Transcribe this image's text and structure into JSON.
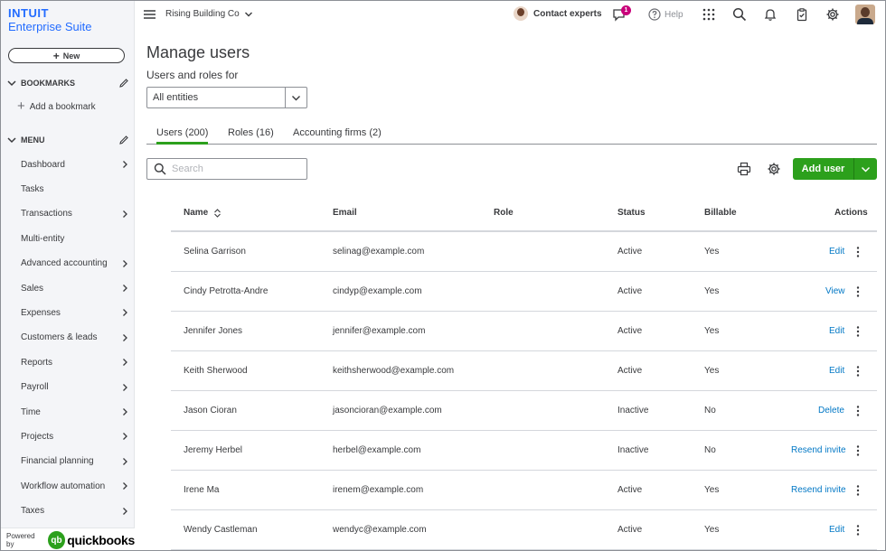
{
  "brand": {
    "intuit": "INTUIT",
    "suite": "Enterprise Suite"
  },
  "sidebar": {
    "new_label": "New",
    "bookmarks_header": "BOOKMARKS",
    "add_bookmark": "Add a bookmark",
    "menu_header": "MENU",
    "items": [
      {
        "label": "Dashboard",
        "chevron": true
      },
      {
        "label": "Tasks",
        "chevron": false
      },
      {
        "label": "Transactions",
        "chevron": true
      },
      {
        "label": "Multi-entity",
        "chevron": false
      },
      {
        "label": "Advanced accounting",
        "chevron": true
      },
      {
        "label": "Sales",
        "chevron": true
      },
      {
        "label": "Expenses",
        "chevron": true
      },
      {
        "label": "Customers & leads",
        "chevron": true
      },
      {
        "label": "Reports",
        "chevron": true
      },
      {
        "label": "Payroll",
        "chevron": true
      },
      {
        "label": "Time",
        "chevron": true
      },
      {
        "label": "Projects",
        "chevron": true
      },
      {
        "label": "Financial planning",
        "chevron": true
      },
      {
        "label": "Workflow automation",
        "chevron": true
      },
      {
        "label": "Taxes",
        "chevron": true
      }
    ],
    "powered_by": "Powered by",
    "qb_mark": "qb",
    "qb_word": "quickbooks"
  },
  "topbar": {
    "company": "Rising Building Co",
    "contact_experts": "Contact experts",
    "notification_count": "1",
    "help": "Help"
  },
  "main": {
    "title": "Manage users",
    "subtitle": "Users and roles for",
    "entity_select": "All entities",
    "tabs": [
      {
        "label": "Users (200)",
        "active": true
      },
      {
        "label": "Roles (16)",
        "active": false
      },
      {
        "label": "Accounting firms (2)",
        "active": false
      }
    ],
    "search_placeholder": "Search",
    "add_user": "Add user"
  },
  "table": {
    "headers": {
      "name": "Name",
      "email": "Email",
      "role": "Role",
      "status": "Status",
      "billable": "Billable",
      "actions": "Actions"
    },
    "rows": [
      {
        "name": "Selina Garrison",
        "email": "selinag@example.com",
        "role": "",
        "status": "Active",
        "billable": "Yes",
        "action": "Edit"
      },
      {
        "name": "Cindy Petrotta-Andre",
        "email": "cindyp@example.com",
        "role": "",
        "status": "Active",
        "billable": "Yes",
        "action": "View"
      },
      {
        "name": "Jennifer Jones",
        "email": "jennifer@example.com",
        "role": "",
        "status": "Active",
        "billable": "Yes",
        "action": "Edit"
      },
      {
        "name": "Keith Sherwood",
        "email": "keithsherwood@example.com",
        "role": "",
        "status": "Active",
        "billable": "Yes",
        "action": "Edit"
      },
      {
        "name": "Jason Cioran",
        "email": "jasoncioran@example.com",
        "role": "",
        "status": "Inactive",
        "billable": "No",
        "action": "Delete"
      },
      {
        "name": "Jeremy Herbel",
        "email": "herbel@example.com",
        "role": "",
        "status": "Inactive",
        "billable": "No",
        "action": "Resend invite"
      },
      {
        "name": "Irene Ma",
        "email": "irenem@example.com",
        "role": "",
        "status": "Active",
        "billable": "Yes",
        "action": "Resend invite"
      },
      {
        "name": "Wendy Castleman",
        "email": "wendyc@example.com",
        "role": "",
        "status": "Active",
        "billable": "Yes",
        "action": "Edit"
      }
    ]
  },
  "colors": {
    "brand_blue": "#236cff",
    "green": "#2ca01c",
    "link": "#0077c5",
    "badge": "#c9007a"
  },
  "icons": [
    "plus-icon",
    "pencil-icon",
    "chevron-down-icon",
    "chevron-right-icon",
    "hamburger-icon",
    "chat-icon",
    "help-icon",
    "apps-grid-icon",
    "search-icon",
    "bell-icon",
    "clipboard-icon",
    "gear-icon",
    "printer-icon",
    "sort-icon",
    "kebab-icon"
  ]
}
